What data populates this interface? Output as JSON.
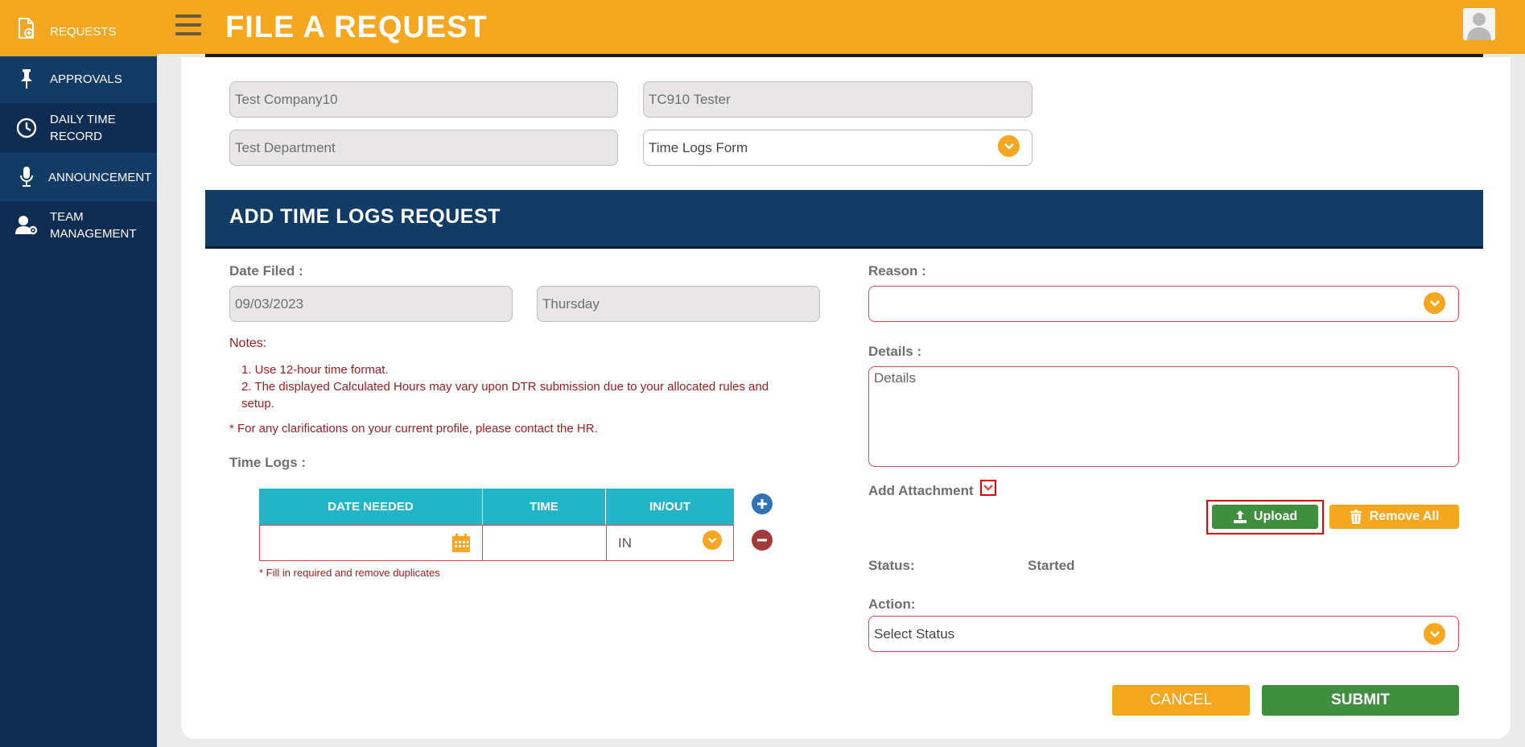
{
  "sidebar": {
    "items": [
      {
        "label": "REQUESTS",
        "icon": "document-plus-icon"
      },
      {
        "label": "APPROVALS",
        "icon": "pin-icon"
      },
      {
        "label_line1": "DAILY TIME",
        "label_line2": "RECORD",
        "icon": "clock-icon"
      },
      {
        "label": "ANNOUNCEMENT",
        "icon": "microphone-icon"
      },
      {
        "label_line1": "TEAM",
        "label_line2": "MANAGEMENT",
        "icon": "user-gear-icon"
      }
    ]
  },
  "header": {
    "title": "FILE A REQUEST"
  },
  "form_top": {
    "company": "Test Company10",
    "employee": "TC910 Tester",
    "department": "Test Department",
    "form_type": "Time Logs Form"
  },
  "section": {
    "title": "ADD TIME LOGS REQUEST"
  },
  "left": {
    "date_filed_label": "Date Filed :",
    "date_filed": "09/03/2023",
    "day": "Thursday",
    "notes_label": "Notes:",
    "note1": "1. Use 12-hour time format.",
    "note2a": "2. The displayed Calculated Hours may vary upon DTR submission due to your allocated rules and",
    "note2b": "setup.",
    "clarification": "* For any clarifications on your current profile, please contact the HR.",
    "time_logs_label": "Time Logs :",
    "table": {
      "headers": [
        "DATE NEEDED",
        "TIME",
        "IN/OUT"
      ],
      "row": {
        "date": "",
        "time": "",
        "inout": "IN"
      }
    },
    "fill_note": "* Fill in required and remove duplicates"
  },
  "right": {
    "reason_label": "Reason :",
    "reason_value": "",
    "details_label": "Details :",
    "details_placeholder": "Details",
    "attachment_label": "Add Attachment",
    "upload_label": "Upload",
    "remove_all_label": "Remove All",
    "status_label": "Status:",
    "status_value": "Started",
    "action_label": "Action:",
    "action_value": "Select Status"
  },
  "buttons": {
    "cancel": "CANCEL",
    "submit": "SUBMIT"
  },
  "colors": {
    "accent": "#f5a81f",
    "navy": "#0f2d52",
    "teal": "#22b5c8",
    "green": "#3f8f3f",
    "error_red": "#d9474e"
  }
}
